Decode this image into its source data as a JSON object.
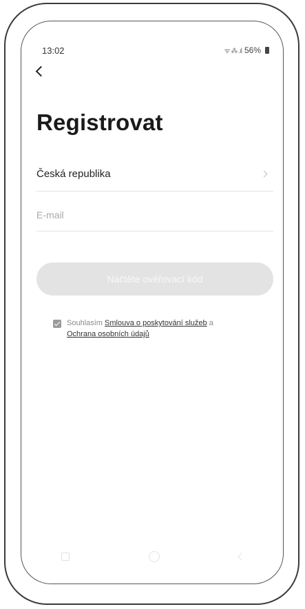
{
  "status_bar": {
    "time": "13:02",
    "signal": "ᯤ ⁂ .ıl",
    "battery": "56%"
  },
  "header": {
    "title": "Registrovat"
  },
  "form": {
    "country": "Česká republika",
    "email_placeholder": "E-mail",
    "verify_button_label": "Načtěte ověřovací kód"
  },
  "consent": {
    "checked": true,
    "prefix": "Souhlasím",
    "terms_link": "Smlouva o poskytování služeb",
    "conjunction": "a",
    "privacy_link": "Ochrana osobních údajů"
  },
  "icons": {
    "back": "chevron-left-icon",
    "country_chevron": "chevron-right-icon",
    "checkbox": "checkbox-checked-icon",
    "nav_recent": "recent-apps-icon",
    "nav_home": "home-icon",
    "nav_back": "back-icon"
  },
  "colors": {
    "title": "#1a1a1a",
    "button_disabled_bg": "#e3e3e3",
    "button_disabled_text": "#f8f8f8",
    "checkbox": "#9a9a9a"
  }
}
